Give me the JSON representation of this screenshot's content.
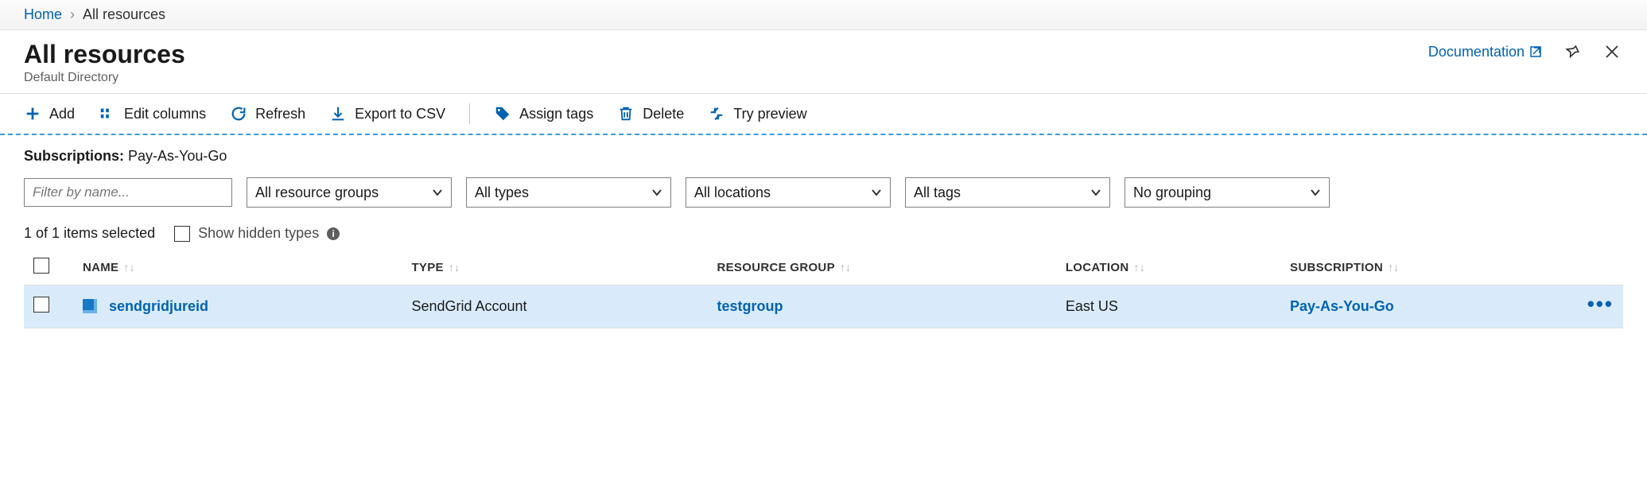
{
  "breadcrumb": {
    "home": "Home",
    "current": "All resources"
  },
  "header": {
    "title": "All resources",
    "subtitle": "Default Directory",
    "documentation": "Documentation"
  },
  "toolbar": {
    "add": "Add",
    "edit_columns": "Edit columns",
    "refresh": "Refresh",
    "export_csv": "Export to CSV",
    "assign_tags": "Assign tags",
    "delete": "Delete",
    "try_preview": "Try preview"
  },
  "filters": {
    "subscriptions_label": "Subscriptions:",
    "subscriptions_value": "Pay-As-You-Go",
    "filter_placeholder": "Filter by name...",
    "resource_groups": "All resource groups",
    "types": "All types",
    "locations": "All locations",
    "tags": "All tags",
    "grouping": "No grouping"
  },
  "selection": {
    "count_text": "1 of 1 items selected",
    "show_hidden": "Show hidden types"
  },
  "columns": {
    "name": "NAME",
    "type": "TYPE",
    "resource_group": "RESOURCE GROUP",
    "location": "LOCATION",
    "subscription": "SUBSCRIPTION"
  },
  "rows": [
    {
      "name": "sendgridjureid",
      "type": "SendGrid Account",
      "resource_group": "testgroup",
      "location": "East US",
      "subscription": "Pay-As-You-Go"
    }
  ]
}
